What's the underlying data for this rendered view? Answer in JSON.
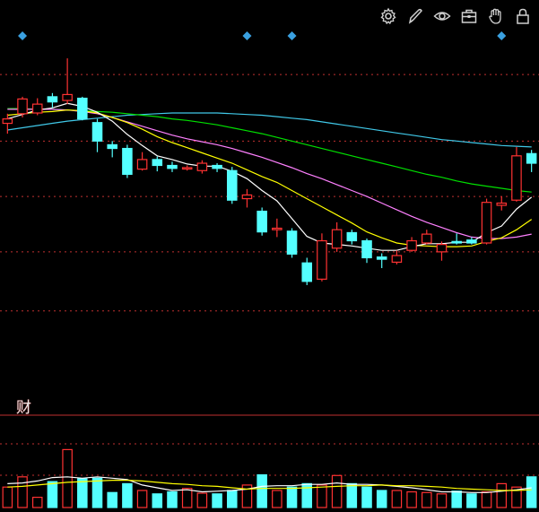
{
  "colors": {
    "background": "#000000",
    "up": "#ff3232",
    "down": "#54ffff",
    "grid": "#c03030",
    "ma5": "#ffffff",
    "ma10": "#ffff00",
    "ma20": "#ff80ff",
    "ma40": "#00e000",
    "ma60": "#40c8e8",
    "marker": "#3aa0e0"
  },
  "toolbar": {
    "icons": [
      "gear-icon",
      "pen-icon",
      "eye-icon",
      "toolbox-icon",
      "hand-icon",
      "lock-icon"
    ]
  },
  "sub_panel_label": "财",
  "chart_data": [
    {
      "type": "candlestick",
      "candles": [
        {
          "o": 54.4,
          "c": 55.0,
          "h": 55.7,
          "l": 53.0
        },
        {
          "o": 55.7,
          "c": 57.7,
          "h": 58.0,
          "l": 55.2
        },
        {
          "o": 55.8,
          "c": 57.0,
          "h": 57.8,
          "l": 55.5
        },
        {
          "o": 58.0,
          "c": 57.3,
          "h": 58.5,
          "l": 56.5
        },
        {
          "o": 57.5,
          "c": 58.3,
          "h": 63.2,
          "l": 57.0
        },
        {
          "o": 57.8,
          "c": 55.0,
          "h": 58.0,
          "l": 54.8
        },
        {
          "o": 54.5,
          "c": 52.0,
          "h": 55.0,
          "l": 50.5
        },
        {
          "o": 51.5,
          "c": 51.0,
          "h": 52.0,
          "l": 49.8
        },
        {
          "o": 51.0,
          "c": 47.5,
          "h": 51.5,
          "l": 47.0
        },
        {
          "o": 48.2,
          "c": 49.5,
          "h": 50.5,
          "l": 48.0
        },
        {
          "o": 49.5,
          "c": 48.7,
          "h": 49.9,
          "l": 47.9
        },
        {
          "o": 48.7,
          "c": 48.3,
          "h": 49.2,
          "l": 47.8
        },
        {
          "o": 48.3,
          "c": 48.4,
          "h": 48.7,
          "l": 48.0
        },
        {
          "o": 48.0,
          "c": 49.0,
          "h": 49.4,
          "l": 47.6
        },
        {
          "o": 48.7,
          "c": 48.3,
          "h": 49.0,
          "l": 47.8
        },
        {
          "o": 48.0,
          "c": 44.0,
          "h": 48.5,
          "l": 43.5
        },
        {
          "o": 44.2,
          "c": 44.7,
          "h": 45.5,
          "l": 43.0
        },
        {
          "o": 42.5,
          "c": 39.7,
          "h": 43.0,
          "l": 39.2
        },
        {
          "o": 40.0,
          "c": 40.2,
          "h": 41.5,
          "l": 39.0
        },
        {
          "o": 39.8,
          "c": 36.7,
          "h": 40.2,
          "l": 36.2
        },
        {
          "o": 35.5,
          "c": 33.0,
          "h": 36.2,
          "l": 32.5
        },
        {
          "o": 33.3,
          "c": 38.5,
          "h": 39.5,
          "l": 33.0
        },
        {
          "o": 37.5,
          "c": 40.0,
          "h": 41.0,
          "l": 37.0
        },
        {
          "o": 39.6,
          "c": 38.5,
          "h": 40.0,
          "l": 38.0
        },
        {
          "o": 38.5,
          "c": 36.2,
          "h": 38.8,
          "l": 35.5
        },
        {
          "o": 36.3,
          "c": 36.0,
          "h": 36.8,
          "l": 34.8
        },
        {
          "o": 35.6,
          "c": 36.5,
          "h": 37.2,
          "l": 35.3
        },
        {
          "o": 37.2,
          "c": 38.5,
          "h": 39.0,
          "l": 37.0
        },
        {
          "o": 38.2,
          "c": 39.4,
          "h": 40.0,
          "l": 38.0
        },
        {
          "o": 37.0,
          "c": 38.0,
          "h": 38.4,
          "l": 35.8
        },
        {
          "o": 38.4,
          "c": 38.2,
          "h": 39.5,
          "l": 38.0
        },
        {
          "o": 38.6,
          "c": 38.2,
          "h": 39.0,
          "l": 38.0
        },
        {
          "o": 38.2,
          "c": 43.7,
          "h": 44.2,
          "l": 38.0
        },
        {
          "o": 43.3,
          "c": 43.6,
          "h": 44.5,
          "l": 42.6
        },
        {
          "o": 44.0,
          "c": 50.0,
          "h": 51.2,
          "l": 43.8
        },
        {
          "o": 50.3,
          "c": 49.0,
          "h": 50.8,
          "l": 47.8
        }
      ],
      "ma5": [
        55.0,
        55.6,
        56.2,
        56.5,
        57.1,
        56.7,
        55.9,
        54.7,
        52.9,
        51.4,
        50.0,
        49.5,
        48.9,
        48.6,
        48.6,
        47.9,
        46.9,
        45.3,
        43.9,
        41.5,
        39.1,
        38.2,
        38.0,
        37.8,
        37.5,
        37.2,
        37.2,
        37.7,
        38.1,
        38.1,
        38.3,
        38.3,
        39.6,
        40.5,
        42.8,
        44.4
      ],
      "ma10": [
        55.5,
        55.7,
        55.9,
        56.0,
        56.2,
        56.1,
        55.8,
        55.2,
        54.5,
        53.6,
        52.6,
        51.8,
        51.1,
        50.4,
        49.7,
        49.0,
        48.1,
        47.2,
        46.4,
        45.3,
        44.2,
        43.1,
        42.0,
        40.9,
        39.7,
        38.9,
        38.2,
        37.9,
        37.8,
        37.7,
        37.7,
        37.8,
        38.4,
        38.9,
        40.0,
        41.4
      ],
      "ma20": [
        56.3,
        56.3,
        56.3,
        56.3,
        56.2,
        56.0,
        55.7,
        55.2,
        54.6,
        54.0,
        53.4,
        52.8,
        52.3,
        51.9,
        51.5,
        51.0,
        50.4,
        49.8,
        49.1,
        48.4,
        47.6,
        46.9,
        46.1,
        45.3,
        44.5,
        43.6,
        42.7,
        41.8,
        41.0,
        40.3,
        39.6,
        39.0,
        38.8,
        38.8,
        39.0,
        39.4
      ],
      "ma40": [
        56.4,
        56.4,
        56.3,
        56.3,
        56.2,
        56.1,
        56.0,
        55.9,
        55.7,
        55.5,
        55.3,
        55.0,
        54.8,
        54.5,
        54.2,
        53.8,
        53.4,
        53.0,
        52.5,
        52.0,
        51.5,
        51.0,
        50.5,
        50.0,
        49.5,
        49.0,
        48.5,
        48.0,
        47.5,
        47.1,
        46.6,
        46.2,
        45.9,
        45.6,
        45.3,
        45.1
      ],
      "ma60": [
        53.5,
        53.8,
        54.1,
        54.4,
        54.7,
        54.9,
        55.1,
        55.3,
        55.5,
        55.6,
        55.7,
        55.8,
        55.8,
        55.8,
        55.8,
        55.7,
        55.6,
        55.5,
        55.3,
        55.1,
        54.9,
        54.6,
        54.3,
        54.0,
        53.7,
        53.4,
        53.1,
        52.8,
        52.5,
        52.2,
        52.0,
        51.8,
        51.6,
        51.4,
        51.3,
        51.2
      ],
      "ylim": [
        28,
        66
      ],
      "grid_y": [
        61,
        52,
        44.5,
        37,
        29
      ],
      "markers_at_index": [
        1,
        16,
        19,
        33
      ]
    },
    {
      "type": "bar",
      "volume": [
        3.0,
        4.5,
        1.5,
        3.8,
        8.5,
        4.2,
        4.3,
        2.2,
        3.5,
        2.5,
        2.0,
        2.3,
        2.8,
        2.1,
        2.0,
        2.5,
        3.3,
        4.8,
        2.5,
        3.0,
        3.5,
        3.3,
        4.7,
        3.5,
        3.0,
        2.5,
        2.5,
        2.3,
        2.2,
        2.0,
        2.4,
        2.0,
        2.3,
        3.5,
        3.0,
        4.5
      ],
      "vol_ma5": [
        3.5,
        3.6,
        3.9,
        4.4,
        4.5,
        4.3,
        4.5,
        4.3,
        4.1,
        3.3,
        2.9,
        2.5,
        2.6,
        2.3,
        2.4,
        2.5,
        2.7,
        3.1,
        3.2,
        3.2,
        3.4,
        3.4,
        3.6,
        3.4,
        3.4,
        3.3,
        3.1,
        2.9,
        2.6,
        2.3,
        2.3,
        2.2,
        2.2,
        2.4,
        2.6,
        2.9
      ],
      "vol_ma10": [
        3.0,
        3.1,
        3.3,
        3.5,
        3.7,
        3.8,
        3.9,
        4.0,
        4.0,
        3.9,
        3.7,
        3.5,
        3.4,
        3.2,
        3.1,
        2.9,
        2.7,
        2.8,
        2.8,
        2.8,
        2.9,
        3.0,
        3.1,
        3.2,
        3.2,
        3.3,
        3.2,
        3.2,
        3.1,
        3.0,
        2.8,
        2.7,
        2.6,
        2.5,
        2.5,
        2.6
      ],
      "ylim": [
        0,
        10
      ]
    }
  ]
}
